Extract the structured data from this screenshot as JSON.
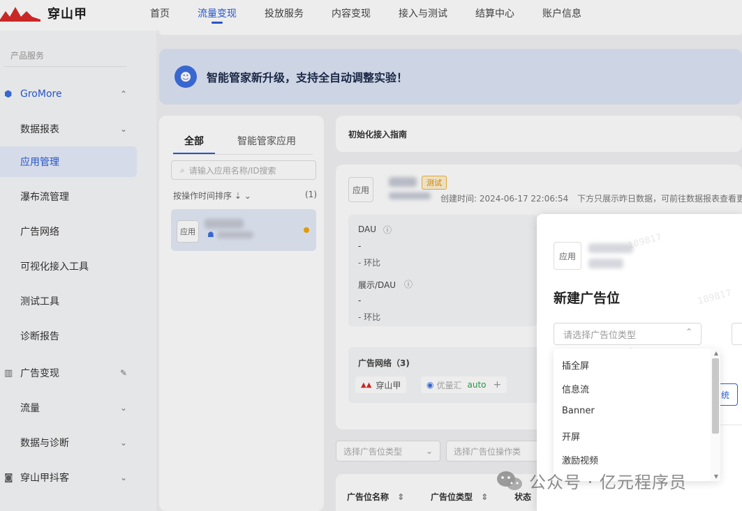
{
  "header": {
    "logo_text": "穿山甲",
    "nav": [
      "首页",
      "流量变现",
      "投放服务",
      "内容变现",
      "接入与测试",
      "结算中心",
      "账户信息"
    ],
    "active_index": 1
  },
  "sidebar": {
    "section": "产品服务",
    "items": [
      {
        "label": "GroMore"
      },
      {
        "label": "数据报表"
      },
      {
        "label": "应用管理"
      },
      {
        "label": "瀑布流管理"
      },
      {
        "label": "广告网络"
      },
      {
        "label": "可视化接入工具"
      },
      {
        "label": "测试工具"
      },
      {
        "label": "诊断报告"
      },
      {
        "label": "广告变现"
      },
      {
        "label": "流量"
      },
      {
        "label": "数据与诊断"
      },
      {
        "label": "穿山甲抖客"
      }
    ]
  },
  "banner": {
    "text": "智能管家新升级，支持全自动调整实验！"
  },
  "app_list": {
    "tabs": [
      "全部",
      "智能管家应用"
    ],
    "search_placeholder": "请输入应用名称/ID搜索",
    "sort_label": "按操作时间排序",
    "count": "(1)",
    "icon_label": "应用"
  },
  "guide": {
    "title": "初始化接入指南"
  },
  "app_detail": {
    "icon_label": "应用",
    "badge": "测试",
    "created": "创建时间: 2024-06-17 22:06:54",
    "note": "下方只展示昨日数据，可前往数据报表查看更",
    "dau_label": "DAU",
    "dau_value": "-",
    "dau_change": "-  环比",
    "show_label": "展示/DAU",
    "show_value": "-",
    "show_change": "-  环比",
    "network_title": "广告网络（3)",
    "networks": [
      "穿山甲",
      "优量汇",
      "auto"
    ]
  },
  "filters": [
    "选择广告位类型",
    "选择广告位操作类"
  ],
  "table_headers": [
    "广告位名称",
    "广告位类型",
    "状态"
  ],
  "dialog": {
    "icon_label": "应用",
    "title": "新建广告位",
    "select_placeholder": "请选择广告位类型",
    "button_fragment": "统",
    "options": [
      "插全屏",
      "信息流",
      "Banner",
      "开屏",
      "激励视频"
    ],
    "watermark": "189817"
  },
  "wechat_watermark": "公众号 · 亿元程序员"
}
